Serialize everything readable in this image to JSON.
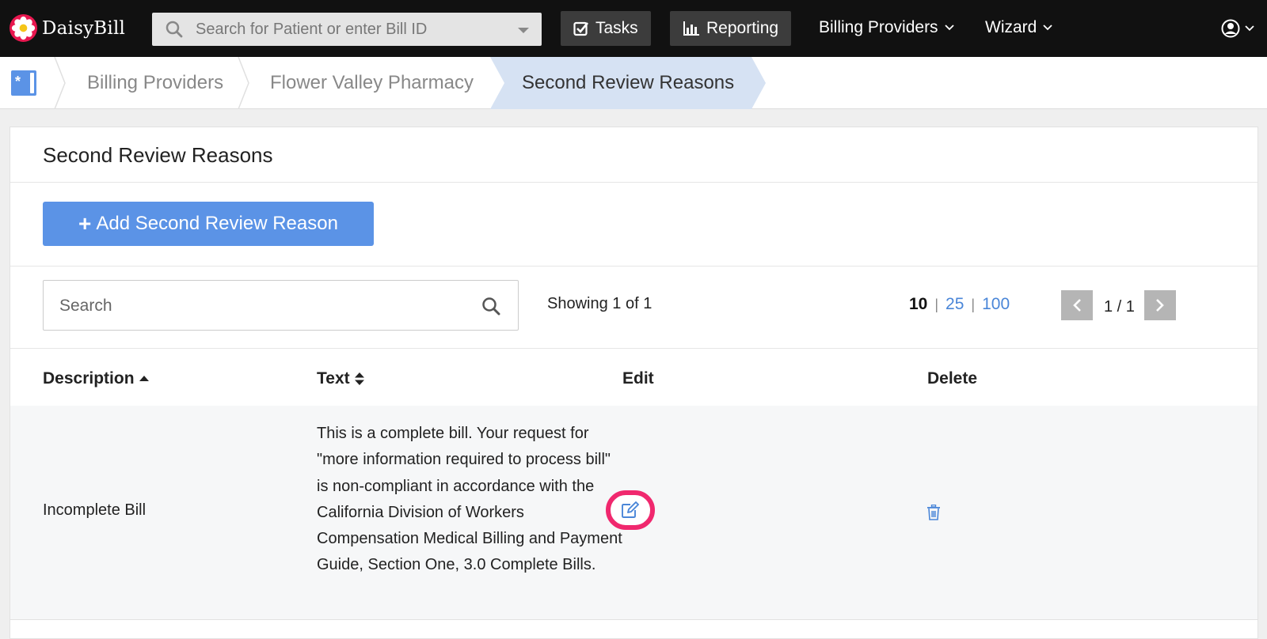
{
  "app": {
    "brand": "DaisyBill"
  },
  "topbar": {
    "search_placeholder": "Search for Patient or enter Bill ID",
    "tasks_label": "Tasks",
    "reporting_label": "Reporting",
    "billing_providers_label": "Billing Providers",
    "wizard_label": "Wizard"
  },
  "breadcrumb": {
    "items": [
      "Billing Providers",
      "Flower Valley Pharmacy",
      "Second Review Reasons"
    ]
  },
  "page": {
    "title": "Second Review Reasons",
    "add_button_label": "Add Second Review Reason"
  },
  "table_tools": {
    "search_placeholder": "Search",
    "showing_text": "Showing 1 of 1",
    "per_page": {
      "current": "10",
      "options": [
        "25",
        "100"
      ]
    },
    "pagination_text": "1 / 1"
  },
  "table": {
    "columns": [
      "Description",
      "Text",
      "Edit",
      "Delete"
    ],
    "rows": [
      {
        "description": "Incomplete Bill",
        "text": "This is a complete bill. Your request for \"more information required to process bill\" is non-compliant in accordance with the California Division of Workers Compensation Medical Billing and Payment Guide, Section One, 3.0 Complete Bills."
      }
    ]
  },
  "colors": {
    "topbar": "#111111",
    "accent": "#5b93e6",
    "link": "#4a86d8",
    "highlight": "#f0286e",
    "active_crumb": "#d6e2f3"
  }
}
